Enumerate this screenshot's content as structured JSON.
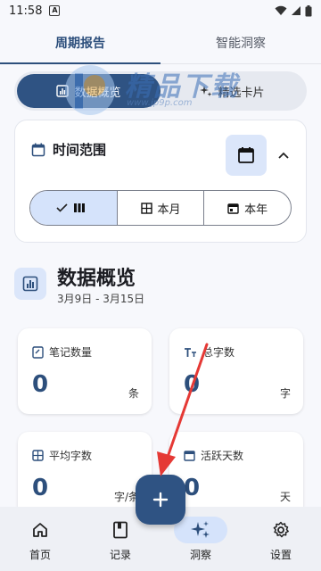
{
  "status_bar": {
    "time": "11:58",
    "notif_glyph": "A"
  },
  "top_tabs": [
    {
      "label": "周期报告",
      "active": true
    },
    {
      "label": "智能洞察",
      "active": false
    }
  ],
  "view_switch": [
    {
      "label": "数据概览",
      "icon": "chart-icon",
      "active": true
    },
    {
      "label": "精选卡片",
      "icon": "sparkle-icon",
      "active": false
    }
  ],
  "range_card": {
    "title": "时间范围",
    "options": [
      {
        "label": "",
        "icon": "week-icon",
        "active": true
      },
      {
        "label": "本月",
        "icon": "grid-icon",
        "active": false
      },
      {
        "label": "本年",
        "icon": "calendar-icon",
        "active": false
      }
    ]
  },
  "overview": {
    "title": "数据概览",
    "date_range": "3月9日 - 3月15日"
  },
  "stats": [
    {
      "label": "笔记数量",
      "value": "0",
      "unit": "条",
      "icon": "note-icon"
    },
    {
      "label": "总字数",
      "value": "0",
      "unit": "字",
      "icon": "text-size-icon"
    },
    {
      "label": "平均字数",
      "value": "0",
      "unit": "字/条",
      "icon": "calculator-icon"
    },
    {
      "label": "活跃天数",
      "value": "0",
      "unit": "天",
      "icon": "calendar-icon"
    }
  ],
  "bottom_nav": [
    {
      "label": "首页",
      "icon": "home-icon",
      "active": false
    },
    {
      "label": "记录",
      "icon": "book-icon",
      "active": false
    },
    {
      "label": "洞察",
      "icon": "sparkle-icon",
      "active": true
    },
    {
      "label": "设置",
      "icon": "gear-icon",
      "active": false
    }
  ],
  "watermark": {
    "text": "精品下载",
    "url": "www.jp9p.com"
  },
  "colors": {
    "primary": "#2f5383",
    "accent_light": "#d5e3fb",
    "arrow": "#e53935"
  }
}
